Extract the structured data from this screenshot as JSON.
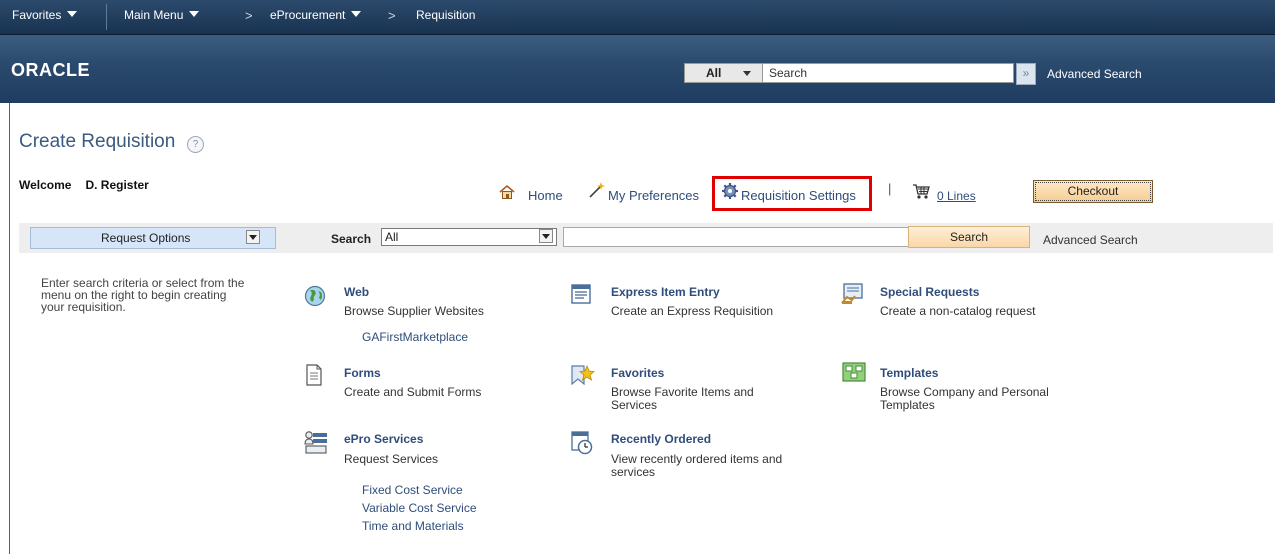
{
  "nav": {
    "favorites": "Favorites",
    "main_menu": "Main Menu",
    "eprocurement": "eProcurement",
    "requisition": "Requisition",
    "chevron": ">"
  },
  "header": {
    "logo": "ORACLE",
    "search_scope": "All",
    "search_placeholder": "Search",
    "advanced_search": "Advanced Search"
  },
  "page": {
    "title": "Create Requisition",
    "help": "?",
    "welcome_label": "Welcome",
    "user_name": "D. Register"
  },
  "links": {
    "home": "Home",
    "preferences": "My Preferences",
    "settings": "Requisition Settings",
    "separator": "|",
    "lines": "0 Lines",
    "checkout": "Checkout"
  },
  "search_bar": {
    "request_options": "Request Options",
    "label": "Search",
    "category": "All",
    "button": "Search",
    "advanced": "Advanced Search"
  },
  "instructions": "Enter search criteria or select from the menu on the right to begin creating your requisition.",
  "options": {
    "web": {
      "title": "Web",
      "desc": "Browse Supplier Websites",
      "links": [
        "GAFirstMarketplace"
      ]
    },
    "express": {
      "title": "Express Item Entry",
      "desc": "Create an Express Requisition"
    },
    "special": {
      "title": "Special Requests",
      "desc": "Create a non-catalog request"
    },
    "forms": {
      "title": "Forms",
      "desc": "Create and Submit Forms"
    },
    "favorites": {
      "title": "Favorites",
      "desc": "Browse Favorite Items and Services"
    },
    "templates": {
      "title": "Templates",
      "desc": "Browse Company and Personal Templates"
    },
    "epro": {
      "title": "ePro Services",
      "desc": "Request Services",
      "links": [
        "Fixed Cost Service",
        "Variable Cost Service",
        "Time and Materials"
      ]
    },
    "recent": {
      "title": "Recently Ordered",
      "desc": "View recently ordered items and services"
    }
  },
  "colors": {
    "nav_bg": "#1f3d60",
    "link": "#2f4d7a",
    "highlight": "#e10000",
    "checkout_bg": "#f6cc92"
  }
}
